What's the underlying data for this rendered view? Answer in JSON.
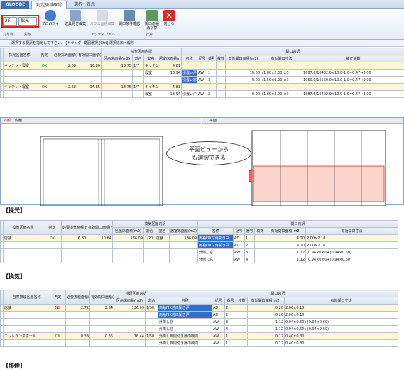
{
  "tabs": {
    "app": "GLOOBE",
    "t1": "判定領域確認",
    "t2": "選択・表示"
  },
  "ribbon": {
    "floor": "2F",
    "mode": "採光",
    "buttons": [
      "プロパティ",
      "建具見付編集",
      "ガラス面積編集",
      "開口条件確認",
      "開口面積再計算",
      "閉じる"
    ],
    "groups": [
      "対象物",
      "対象",
      "アクティブセル",
      "計算"
    ]
  },
  "hint": "選択する要素を指定して下さい。 [ドラッグ] 範囲選択 [Ctrl] 選択追加・解除",
  "light": {
    "label": "【採光】",
    "h1": [
      "採光区画名称",
      "判定",
      "必要採光面積(m2)",
      "有効開口面積(m2)",
      "採光区画内訳",
      "開口内訳"
    ],
    "h2": [
      "区画床面積(m2)",
      "割合",
      "室名",
      "居室床面積(m2)",
      "名称",
      "記号",
      "番号",
      "枚数",
      "有効開口面積(m2)",
      "有効開口寸法",
      "補正係数"
    ],
    "rows": [
      [
        "キッチン・寝室",
        "OK",
        "2.68",
        "10.80",
        "18.75",
        "1/7",
        "キッチン",
        "4.81",
        "",
        "",
        "",
        "",
        "",
        "",
        ""
      ],
      [
        "",
        "",
        "",
        "",
        "",
        "",
        "寝室",
        "13.94",
        "引違い戸",
        "AW",
        "1",
        "",
        "10.80",
        "(1.80×2.00)×3",
        "1887.6/16402.0×10.0-1.0=0.47→3.00"
      ],
      [
        "",
        "",
        "",
        "",
        "",
        "",
        "",
        "",
        "引違い窓",
        "AW",
        "3",
        "",
        "0.00",
        "(1.50×0.90)×3",
        "1050.0/16550.0×10.0-1.0=0.47→0.00"
      ],
      [
        "キッチン・寝室",
        "OK",
        "2.68",
        "14.85",
        "18.75",
        "1/7",
        "キッチン",
        "4.81",
        "",
        "",
        "",
        "",
        "",
        "",
        ""
      ],
      [
        "",
        "",
        "",
        "",
        "",
        "",
        "寝室",
        "13.94",
        "引違い戸",
        "AW",
        "2",
        "",
        "0.00",
        "(1.80×2.00)×3",
        "1887.6/16402.0×10.0-1.0=0.47→3.00"
      ]
    ]
  },
  "view": {
    "tab1": "外観",
    "tab2": "内観",
    "plan": "平面",
    "callout1": "平面ビューから",
    "callout2": "も選択できる"
  },
  "vent": {
    "label": "【換気】",
    "h1": [
      "換気区画名称",
      "判定",
      "必要換気面積(m2)",
      "有効開口面積(m2)",
      "換気区画内訳",
      "開口内訳"
    ],
    "h2": [
      "区画床面積(m2)",
      "割合",
      "室名",
      "居室床面積(m2)",
      "名称",
      "記号",
      "番号",
      "枚数",
      "有効開口面積(m2)",
      "有効開口寸法"
    ],
    "rows": [
      [
        "店舗",
        "OK",
        "6.80",
        "10.64",
        "136.09",
        "1/20",
        "店舗",
        "136.09",
        "両袖FIX付両開き戸",
        "AD",
        "1",
        "",
        "4.20",
        "2.00×2.10"
      ],
      [
        "",
        "",
        "",
        "",
        "",
        "",
        "",
        "",
        "両袖FIX付両開き戸",
        "AD",
        "2",
        "",
        "4.20",
        "2.00×2.10"
      ],
      [
        "",
        "",
        "",
        "",
        "",
        "",
        "",
        "",
        "外倒し窓",
        "AW",
        "3",
        "",
        "1.12",
        "(0.94×0.60+(0.94×0.60)"
      ],
      [
        "",
        "",
        "",
        "",
        "",
        "",
        "",
        "",
        "外倒し窓",
        "AW",
        "4",
        "",
        "1.12",
        "(0.94×0.60+(0.94×0.60)"
      ]
    ]
  },
  "smoke": {
    "label": "【排煙】",
    "h1": [
      "自然排煙区画名称",
      "判定",
      "必要排煙面積(m2)",
      "有効開口面積(m2)",
      "排煙区画内訳",
      "開口内訳"
    ],
    "h2": [
      "区画床面積(m2)",
      "割合",
      "名称",
      "記号",
      "番号",
      "枚数",
      "有効開口面積(m2)",
      "有効開口寸法"
    ],
    "rows": [
      [
        "店舗",
        "NG",
        "2.72",
        "2.64",
        "136.09",
        "1/50",
        "両袖FIX付両開き戸",
        "AD",
        "2",
        "",
        "0.20",
        "2.00×0.10"
      ],
      [
        "",
        "",
        "",
        "",
        "",
        "",
        "両袖FIX付両開き戸",
        "AD",
        "2",
        "",
        "0.20",
        "2.00×0.10"
      ],
      [
        "",
        "",
        "",
        "",
        "",
        "",
        "外倒し窓",
        "AW",
        "3",
        "",
        "1.12",
        "0.94×0.60+(0.94×0.60)"
      ],
      [
        "",
        "",
        "",
        "",
        "",
        "",
        "外倒し窓",
        "AW",
        "4",
        "",
        "1.12",
        "0.94×0.60+(0.94×0.60)"
      ],
      [
        "エントランスホール",
        "OK",
        "0.33",
        "0.36",
        "16.44",
        "1/50",
        "外倒し欄間付き扉の欄間",
        "AW",
        "1",
        "",
        "0.12",
        "0.40×0.30"
      ],
      [
        "",
        "",
        "",
        "",
        "",
        "",
        "外倒し欄間付き扉の欄間",
        "AW",
        "1",
        "",
        "0.12",
        "0.40×0.30"
      ]
    ]
  }
}
